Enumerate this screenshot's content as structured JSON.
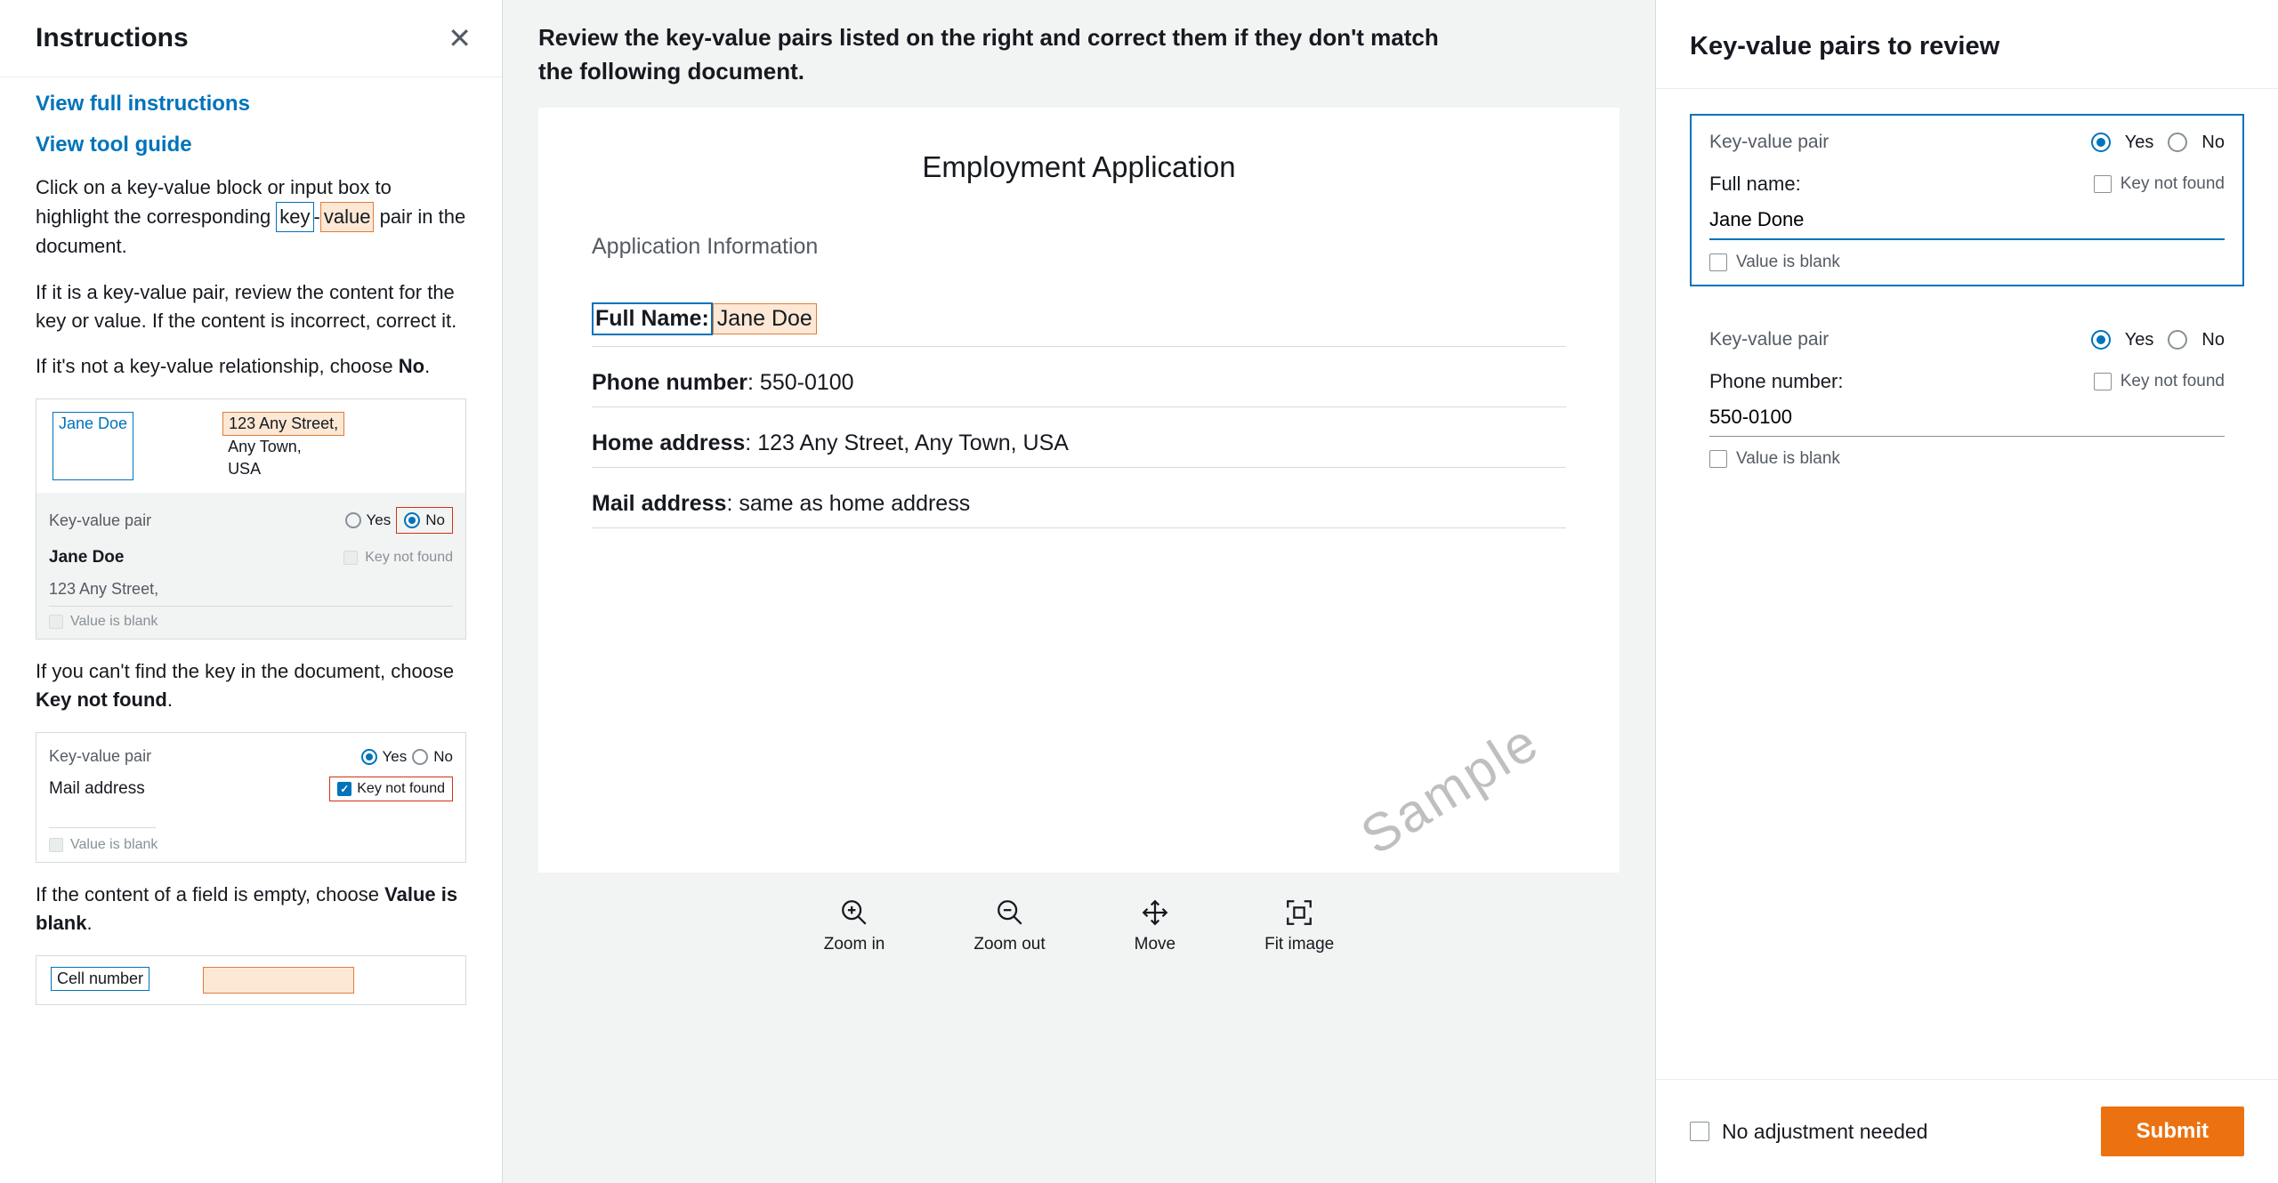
{
  "instructions": {
    "title": "Instructions",
    "link_full": "View full instructions",
    "link_tool": "View tool guide",
    "p1_a": "Click on a key-value block or input box to highlight the corresponding ",
    "p1_key": "key",
    "p1_dash": "-",
    "p1_val": "value",
    "p1_b": " pair in the document.",
    "p2": "If it is a key-value pair, review the content for the key or value. If the content is incorrect, correct it.",
    "p3_a": "If it's not a key-value relationship, choose ",
    "p3_b": "No",
    "p3_c": ".",
    "ex1": {
      "name": "Jane Doe",
      "addr1": "123 Any Street,",
      "addr2": "Any Town,",
      "addr3": "USA",
      "kvp_label": "Key-value pair",
      "yes": "Yes",
      "no": "No",
      "key_line": "Jane Doe",
      "knf": "Key not found",
      "val_line": "123 Any Street,",
      "blank": "Value is blank"
    },
    "p4_a": "If you can't find the key in the document, choose ",
    "p4_b": "Key not found",
    "p4_c": ".",
    "ex2": {
      "kvp_label": "Key-value pair",
      "yes": "Yes",
      "no": "No",
      "key_line": "Mail address",
      "knf": "Key not found",
      "blank": "Value is blank"
    },
    "p5_a": "If the content of a field is empty, choose ",
    "p5_b": "Value is blank",
    "p5_c": ".",
    "ex3": {
      "cell": "Cell number"
    }
  },
  "middle": {
    "header": "Review the key-value pairs listed on the right and correct them if they don't match the following document.",
    "doc": {
      "title": "Employment Application",
      "section": "Application Information",
      "rows": [
        {
          "k": "Full Name:",
          "v": "Jane Doe",
          "highlight": true
        },
        {
          "k": "Phone number",
          "v": "550-0100"
        },
        {
          "k": "Home address",
          "v": "123 Any Street, Any Town, USA"
        },
        {
          "k": "Mail address",
          "v": "same as home address"
        }
      ],
      "watermark": "Sample"
    },
    "tools": {
      "zoom_in": "Zoom in",
      "zoom_out": "Zoom out",
      "move": "Move",
      "fit": "Fit image"
    }
  },
  "right": {
    "title": "Key-value pairs to review",
    "kvp_label": "Key-value pair",
    "yes": "Yes",
    "no": "No",
    "knf": "Key not found",
    "blank": "Value is blank",
    "pairs": [
      {
        "key": "Full name:",
        "value": "Jane Done",
        "active": true
      },
      {
        "key": "Phone number:",
        "value": "550-0100",
        "active": false
      }
    ],
    "footer_cb": "No adjustment needed",
    "submit": "Submit"
  }
}
